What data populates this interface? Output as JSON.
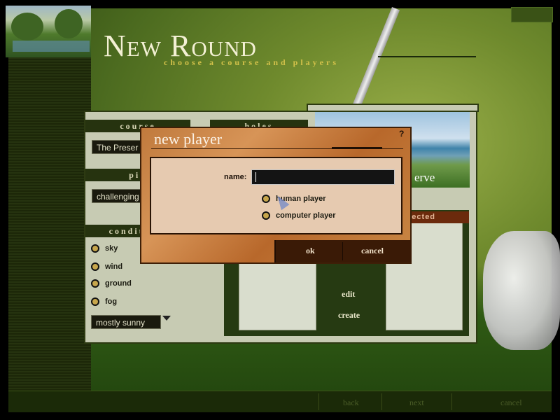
{
  "header": {
    "title": "New Round",
    "subtitle": "choose a course and players"
  },
  "panel": {
    "course_label": "course",
    "course_value": "The Preser",
    "holes_label": "holes",
    "pin_label": "pin",
    "pin_value": "challenging",
    "conditions_label": "conditions",
    "conditions": [
      "sky",
      "wind",
      "ground",
      "fog"
    ],
    "condition_value": "mostly sunny",
    "photo_caption": "erve",
    "selected_label": "selected",
    "edit_label": "edit",
    "create_label": "create"
  },
  "dialog": {
    "title": "new player",
    "help": "?",
    "name_label": "name:",
    "name_value": "",
    "options": [
      "human player",
      "computer player"
    ],
    "ok_label": "ok",
    "cancel_label": "cancel"
  },
  "footer": {
    "back_label": "back",
    "next_label": "next",
    "cancel_label": "cancel"
  },
  "colors": {
    "dialog_wood": "#c98845",
    "panel_bg": "#c7cbb3",
    "selected_bar": "#6b2a0c",
    "title_text": "#f3f0d4",
    "subtitle_text": "#d2c14a"
  }
}
